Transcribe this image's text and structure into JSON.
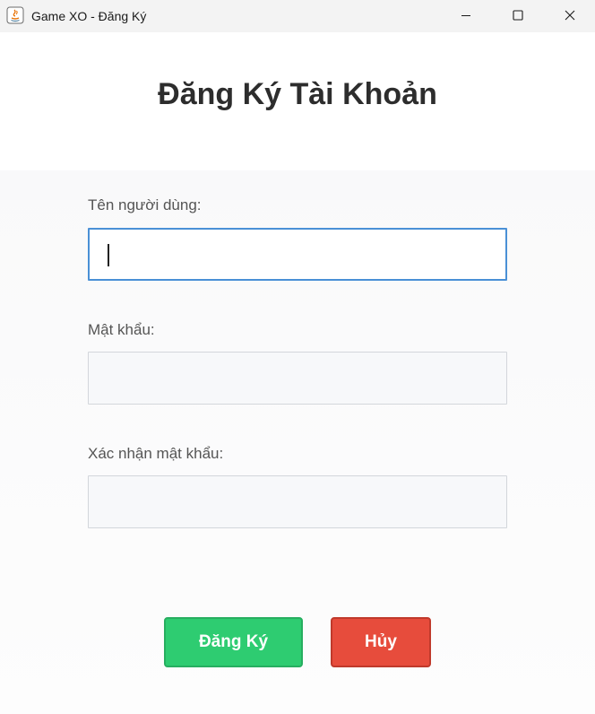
{
  "window": {
    "title": "Game XO - Đăng Ký",
    "icon": "java-icon",
    "controls": [
      "minimize-icon",
      "maximize-icon",
      "close-icon"
    ]
  },
  "form": {
    "heading": "Đăng Ký Tài Khoản",
    "username_label": "Tên người dùng:",
    "username_value": "",
    "password_label": "Mật khẩu:",
    "password_value": "",
    "confirm_label": "Xác nhận mật khẩu:",
    "confirm_value": ""
  },
  "actions": {
    "register_label": "Đăng Ký",
    "cancel_label": "Hủy"
  },
  "colors": {
    "register_button": "#2ecc71",
    "cancel_button": "#e74c3c",
    "focus_border": "#4a90d6"
  }
}
